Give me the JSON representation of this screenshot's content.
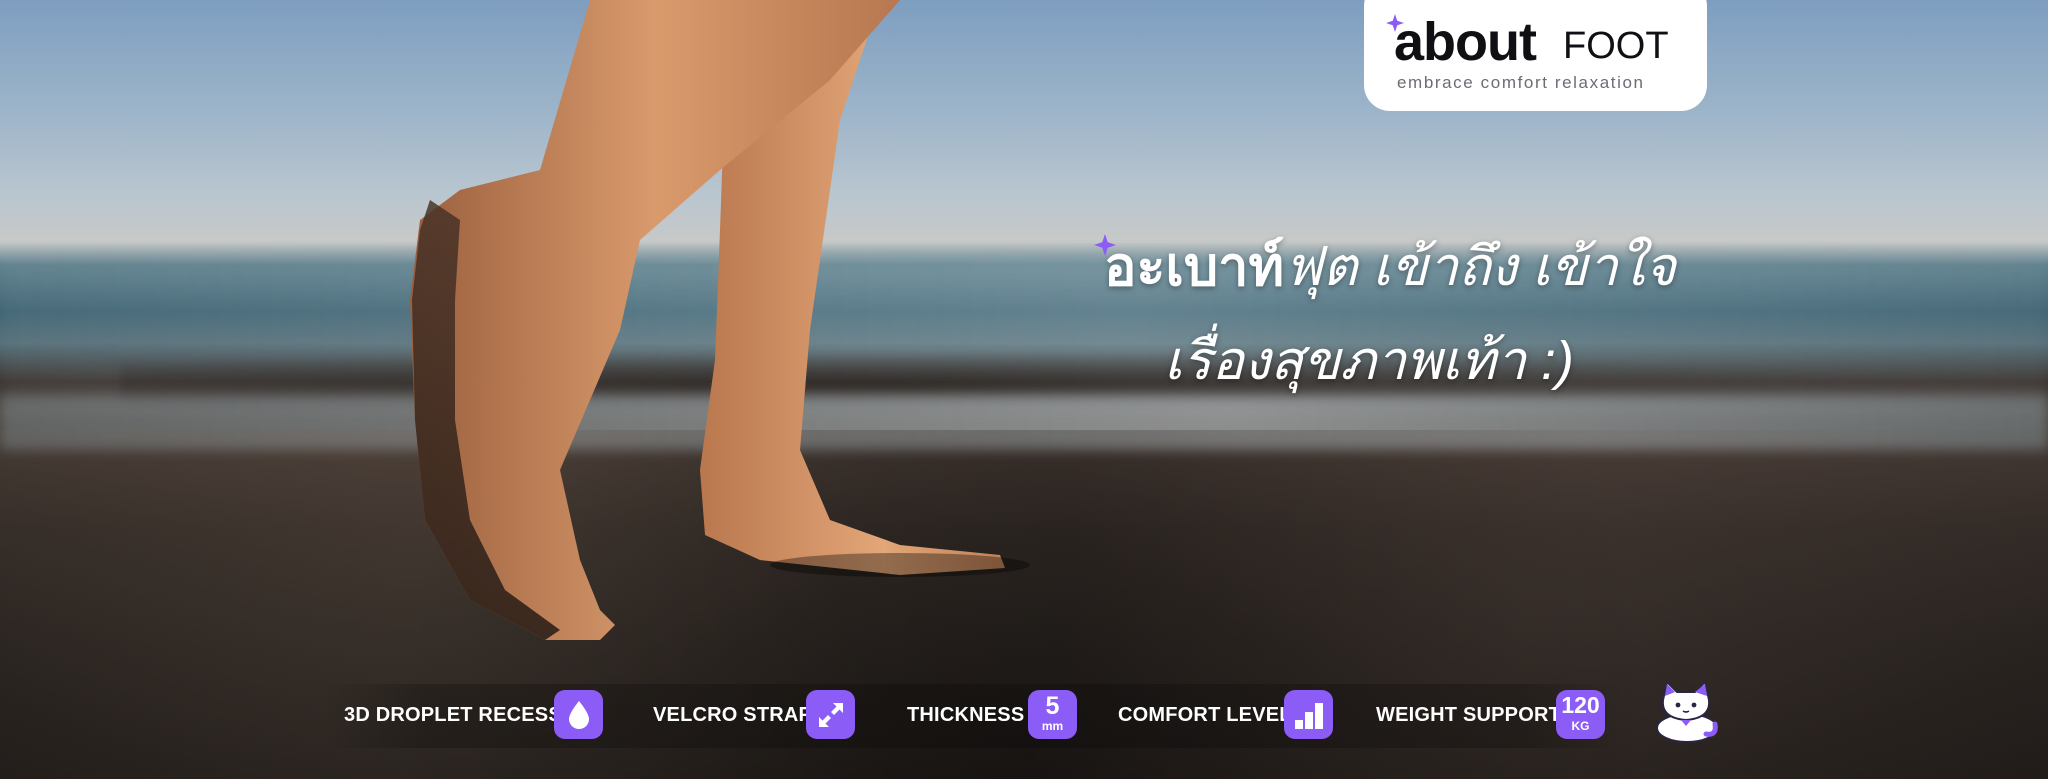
{
  "logo": {
    "name_bold": "about",
    "name_regular": "FOOT",
    "tagline": "embrace comfort relaxation"
  },
  "headline": {
    "line1_brand": "อะเบาท์",
    "line1_rest": "ฟุต เข้าถึง เข้าใจ",
    "line2": "เรื่องสุขภาพเท้า :)"
  },
  "features": [
    {
      "label": "3D DROPLET RECESS",
      "icon": "droplet-icon"
    },
    {
      "label": "VELCRO STRAP",
      "icon": "diagonal-arrows-icon"
    },
    {
      "label": "THICKNESS",
      "icon": "thickness-icon",
      "value": "5",
      "unit": "mm"
    },
    {
      "label": "COMFORT LEVEL",
      "icon": "bar-chart-icon"
    },
    {
      "label": "WEIGHT SUPPORT",
      "icon": "weight-icon",
      "value": "120",
      "unit": "KG"
    }
  ],
  "colors": {
    "accent": "#8b5cf6",
    "logo_background": "#ffffff",
    "text_light": "#ffffff"
  },
  "mascot": {
    "icon": "cat-mascot-icon"
  }
}
